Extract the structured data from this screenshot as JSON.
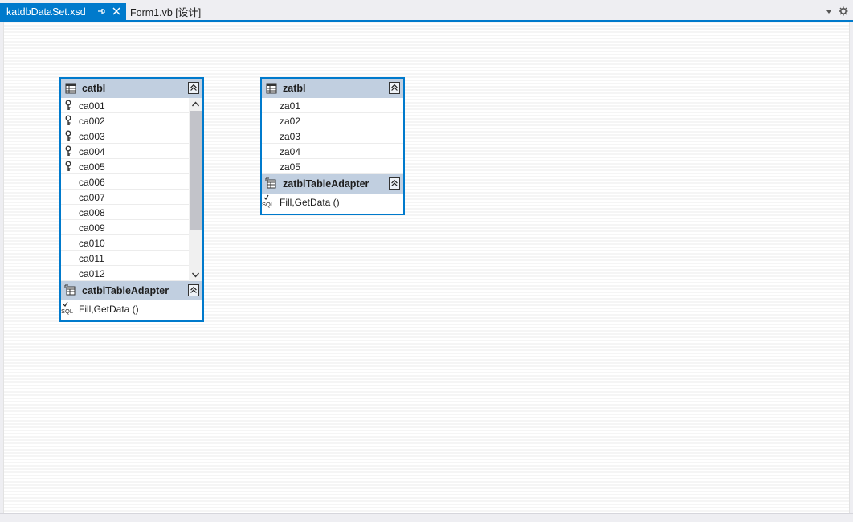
{
  "tabs": [
    {
      "label": "katdbDataSet.xsd",
      "active": true
    },
    {
      "label": "Form1.vb [设计]",
      "active": false
    }
  ],
  "tables": [
    {
      "name": "catbl",
      "columns": [
        {
          "name": "ca001",
          "key": true
        },
        {
          "name": "ca002",
          "key": true
        },
        {
          "name": "ca003",
          "key": true
        },
        {
          "name": "ca004",
          "key": true
        },
        {
          "name": "ca005",
          "key": true
        },
        {
          "name": "ca006",
          "key": false
        },
        {
          "name": "ca007",
          "key": false
        },
        {
          "name": "ca008",
          "key": false
        },
        {
          "name": "ca009",
          "key": false
        },
        {
          "name": "ca010",
          "key": false
        },
        {
          "name": "ca011",
          "key": false
        },
        {
          "name": "ca012",
          "key": false
        }
      ],
      "adapter": {
        "name": "catblTableAdapter",
        "query": "Fill,GetData ()"
      }
    },
    {
      "name": "zatbl",
      "columns": [
        {
          "name": "za01",
          "key": false
        },
        {
          "name": "za02",
          "key": false
        },
        {
          "name": "za03",
          "key": false
        },
        {
          "name": "za04",
          "key": false
        },
        {
          "name": "za05",
          "key": false
        }
      ],
      "adapter": {
        "name": "zatblTableAdapter",
        "query": "Fill,GetData ()"
      }
    }
  ],
  "colors": {
    "accent": "#007acc",
    "header": "#c1cfe0",
    "tabbar": "#eeeef2"
  },
  "icons": {
    "table": "table-icon",
    "adapter": "table-adapter-icon",
    "key": "key-icon",
    "sql": "sql-query-icon",
    "collapse": "collapse-icon",
    "pin": "pin-icon",
    "close": "close-icon",
    "dropdown": "dropdown-icon",
    "settings": "gear-icon"
  }
}
